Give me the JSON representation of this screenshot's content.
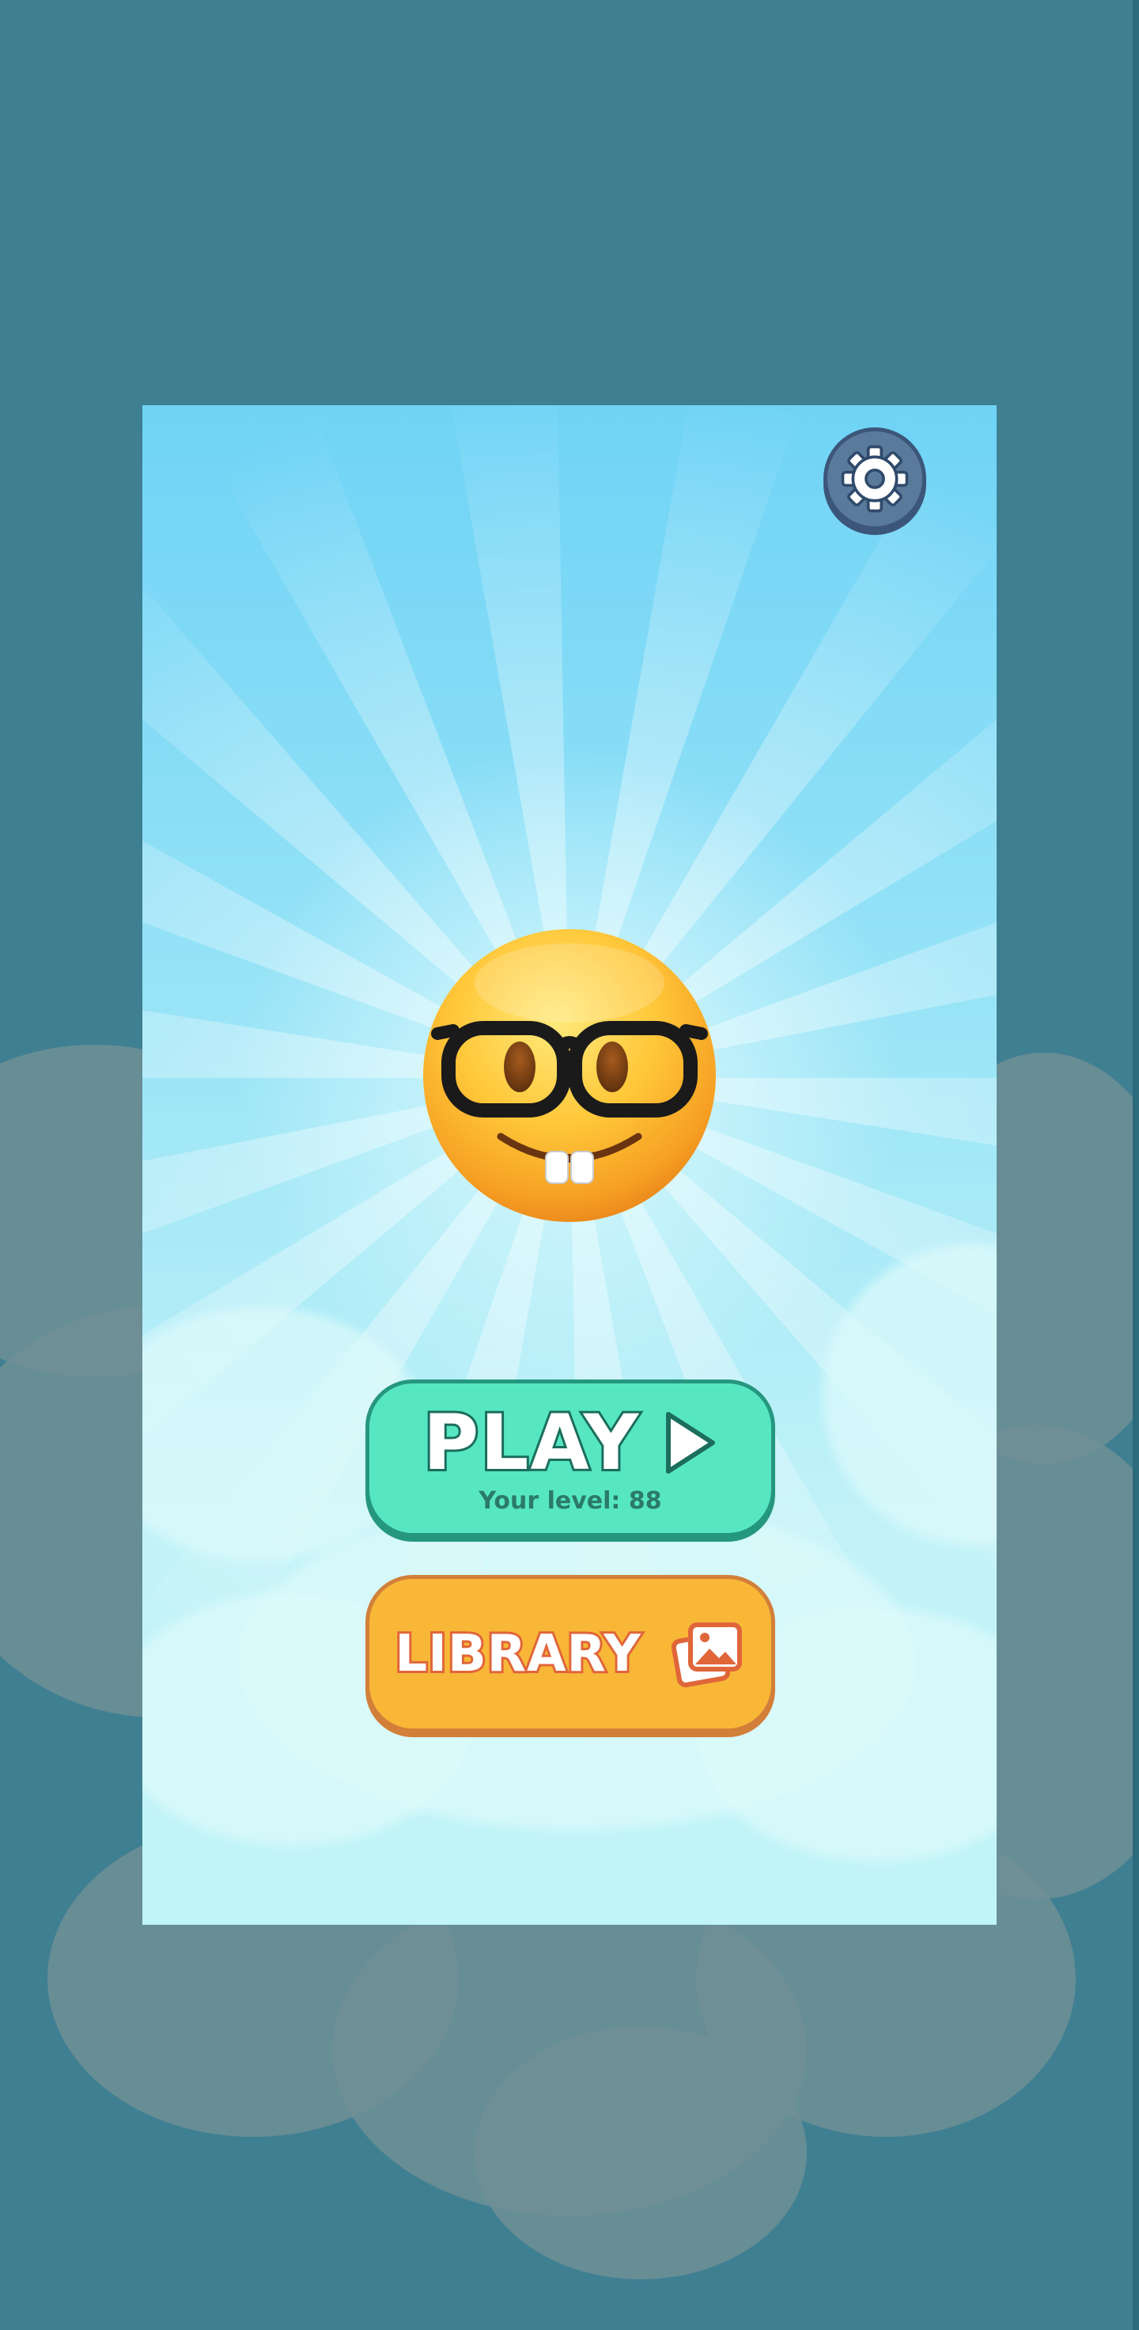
{
  "menu": {
    "play_label": "PLAY",
    "level_text": "Your level: 88",
    "library_label": "LIBRARY"
  },
  "icons": {
    "settings": "gear-icon",
    "play": "play-triangle-icon",
    "library": "gallery-images-icon",
    "mascot": "nerd-face-emoji"
  },
  "colors": {
    "sky_top": "#6fd3f6",
    "sky_bottom": "#c0f4f7",
    "play_button": "#56e7c2",
    "play_border": "#26977f",
    "library_button": "#f8b737",
    "library_border": "#d27f3a",
    "settings_button": "#5a7a9c",
    "backdrop": "#3f7f92"
  }
}
